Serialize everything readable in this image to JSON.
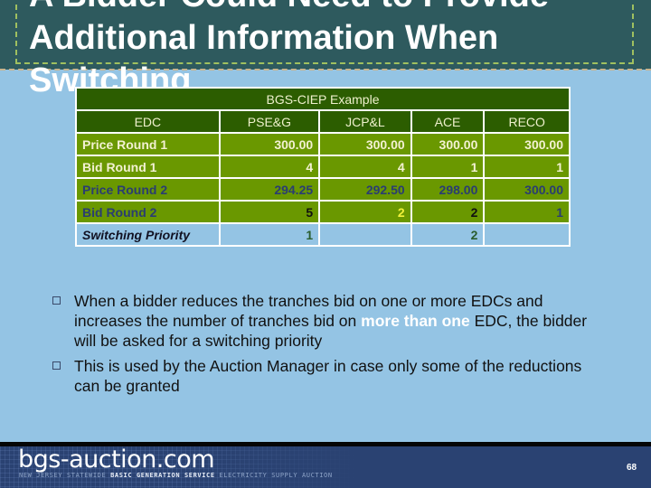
{
  "slide": {
    "title_lines": [
      "A Bidder Could Need to Provide",
      "Additional Information When",
      "Switching"
    ],
    "page_number": "68"
  },
  "table": {
    "title": "BGS-CIEP Example",
    "columns": [
      "EDC",
      "PSE&G",
      "JCP&L",
      "ACE",
      "RECO"
    ],
    "rows": [
      {
        "label": "Price Round 1",
        "values": [
          "300.00",
          "300.00",
          "300.00",
          "300.00"
        ]
      },
      {
        "label": "Bid Round 1",
        "values": [
          "4",
          "4",
          "1",
          "1"
        ]
      },
      {
        "label": "Price Round 2",
        "values": [
          "294.25",
          "292.50",
          "298.00",
          "300.00"
        ]
      },
      {
        "label": "Bid  Round 2",
        "values": [
          "5",
          "2",
          "2",
          "1"
        ]
      },
      {
        "label": "Switching Priority",
        "values": [
          "1",
          "",
          "2",
          ""
        ]
      }
    ]
  },
  "bullets": [
    {
      "before": "When a bidder reduces the tranches bid on one or more EDCs and increases the number of tranches bid on ",
      "highlight": "more than one",
      "after": " EDC, the bidder will be asked for a switching priority"
    },
    {
      "before": "This is used by the Auction Manager in case only some of the reductions can be granted",
      "highlight": "",
      "after": ""
    }
  ],
  "footer": {
    "logo": "bgs-auction.com",
    "tagline_a": "NEW JERSEY STATEWIDE ",
    "tagline_b": "BASIC GENERATION SERVICE",
    "tagline_c": " ELECTRICITY SUPPLY AUCTION"
  },
  "colors": {
    "header_bg": "#2e5a5e",
    "slide_bg": "#94c4e4",
    "table_dark_green": "#2c5d00",
    "table_green": "#6a9800",
    "footer_navy": "#2a4272"
  }
}
